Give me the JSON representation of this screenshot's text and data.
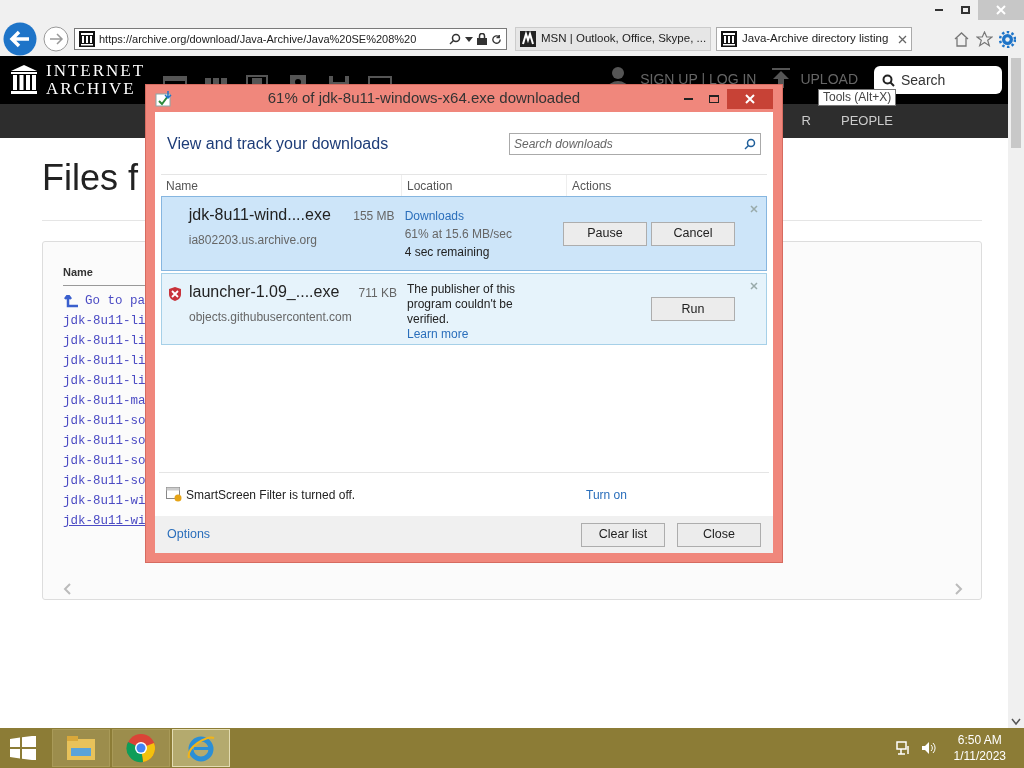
{
  "browser": {
    "url": "https://archive.org/download/Java-Archive/Java%20SE%208%20",
    "tabs": [
      {
        "title": "MSN | Outlook, Office, Skype, ...",
        "kind": "msn",
        "selected": false
      },
      {
        "title": "Java-Archive directory listing",
        "kind": "archive",
        "selected": true
      }
    ]
  },
  "site": {
    "logo_lines": [
      "INTERNET",
      "ARCHIVE"
    ],
    "account": "SIGN UP | LOG IN",
    "upload": "UPLOAD",
    "search_placeholder": "Search",
    "subnav": [
      "R",
      "PEOPLE"
    ]
  },
  "tooltip": "Tools (Alt+X)",
  "page": {
    "heading": "Files f",
    "column": "Name",
    "rows": [
      {
        "kind": "parent",
        "text": "Go to pa",
        "hovered": false
      },
      {
        "kind": "file",
        "text": "jdk-8u11-li",
        "hovered": false
      },
      {
        "kind": "file",
        "text": "jdk-8u11-li",
        "hovered": false
      },
      {
        "kind": "file",
        "text": "jdk-8u11-li",
        "hovered": false
      },
      {
        "kind": "file",
        "text": "jdk-8u11-li",
        "hovered": false
      },
      {
        "kind": "file",
        "text": "jdk-8u11-ma",
        "hovered": false
      },
      {
        "kind": "file",
        "text": "jdk-8u11-so",
        "hovered": false
      },
      {
        "kind": "file",
        "text": "jdk-8u11-so",
        "hovered": false
      },
      {
        "kind": "file",
        "text": "jdk-8u11-so",
        "hovered": false
      },
      {
        "kind": "file",
        "text": "jdk-8u11-so",
        "hovered": false
      },
      {
        "kind": "file",
        "text": "jdk-8u11-wi",
        "hovered": false
      },
      {
        "kind": "file",
        "text": "jdk-8u11-wi",
        "hovered": true
      }
    ]
  },
  "dialog": {
    "title": "61% of jdk-8u11-windows-x64.exe downloaded",
    "heading": "View and track your downloads",
    "search_placeholder": "Search downloads",
    "columns": [
      "Name",
      "Location",
      "Actions"
    ],
    "downloads": [
      {
        "kind": "downloading",
        "selected": true,
        "name": "jdk-8u11-wind....exe",
        "size": "155 MB",
        "source": "ia802203.us.archive.org",
        "location": "Downloads",
        "status": "61% at 15.6 MB/sec",
        "remaining": "4 sec remaining",
        "actions": [
          "Pause",
          "Cancel"
        ]
      },
      {
        "kind": "blocked",
        "selected": false,
        "name": "launcher-1.09_....exe",
        "size": "711 KB",
        "source": "objects.githubusercontent.com",
        "message": "The publisher of this program couldn't be verified.",
        "link": "Learn more",
        "actions": [
          "Run"
        ]
      }
    ],
    "smartscreen": {
      "text": "SmartScreen Filter is turned off.",
      "link": "Turn on"
    },
    "options": "Options",
    "buttons": [
      "Clear list",
      "Close"
    ]
  },
  "taskbar": {
    "apps": [
      {
        "kind": "explorer",
        "selected": false
      },
      {
        "kind": "chrome",
        "selected": false
      },
      {
        "kind": "ie",
        "selected": true
      }
    ],
    "time": "6:50 AM",
    "date": "1/11/2023"
  }
}
